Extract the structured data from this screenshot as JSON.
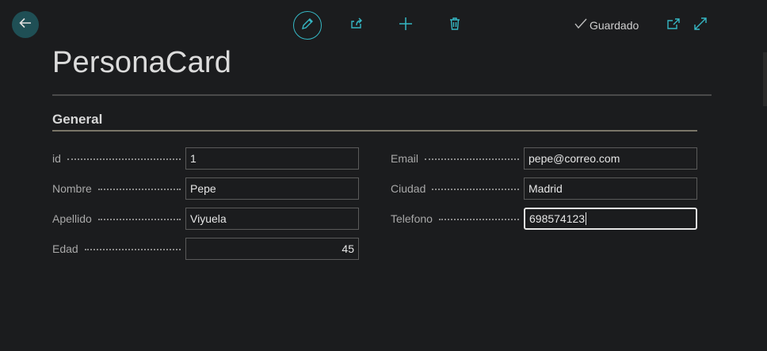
{
  "header": {
    "status_text": "Guardado"
  },
  "page": {
    "title": "PersonaCard"
  },
  "section": {
    "title": "General"
  },
  "fields_left": [
    {
      "label": "id",
      "value": "1"
    },
    {
      "label": "Nombre",
      "value": "Pepe"
    },
    {
      "label": "Apellido",
      "value": "Viyuela"
    },
    {
      "label": "Edad",
      "value": "45"
    }
  ],
  "fields_right": [
    {
      "label": "Email",
      "value": "pepe@correo.com"
    },
    {
      "label": "Ciudad",
      "value": "Madrid"
    },
    {
      "label": "Telefono",
      "value": "698574123"
    }
  ],
  "icons": {
    "back": "arrow-left-icon",
    "edit": "pencil-icon",
    "share": "share-icon",
    "new": "plus-icon",
    "delete": "trash-icon",
    "saved": "checkmark-icon",
    "open_new_window": "open-in-new-window-icon",
    "expand": "expand-icon"
  },
  "colors": {
    "background": "#1b1c1e",
    "accent": "#35b7c4",
    "back_button_bg": "#1f4f55"
  }
}
